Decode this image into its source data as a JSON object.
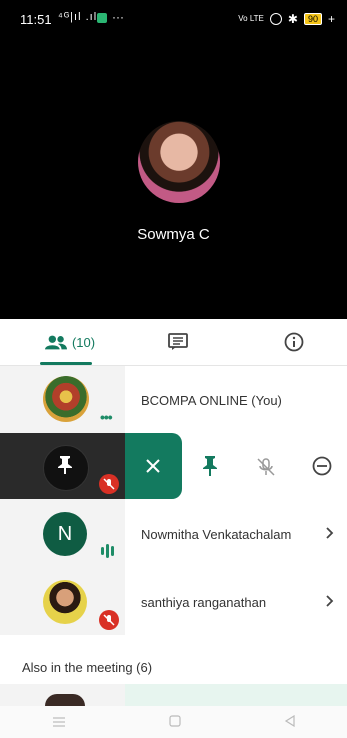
{
  "status_bar": {
    "time": "11:51",
    "signal": "⁴ᴳ|ıl .ıl",
    "more": "···",
    "volte": "Vo LTE",
    "battery": "90"
  },
  "call": {
    "caller_name": "Sowmya C"
  },
  "tabs": {
    "people_count": "(10)"
  },
  "participants": [
    {
      "name": "BCOMPA ONLINE (You)"
    },
    {
      "name": ""
    },
    {
      "name": "Nowmitha Venkatachalam",
      "initial": "N"
    },
    {
      "name": "santhiya ranganathan"
    }
  ],
  "swipe_actions": [
    "close",
    "pin",
    "mute",
    "remove"
  ],
  "section": {
    "also_in_meeting": "Also in the meeting (6)"
  },
  "colors": {
    "accent": "#137a5f",
    "muted_red": "#d93025"
  }
}
